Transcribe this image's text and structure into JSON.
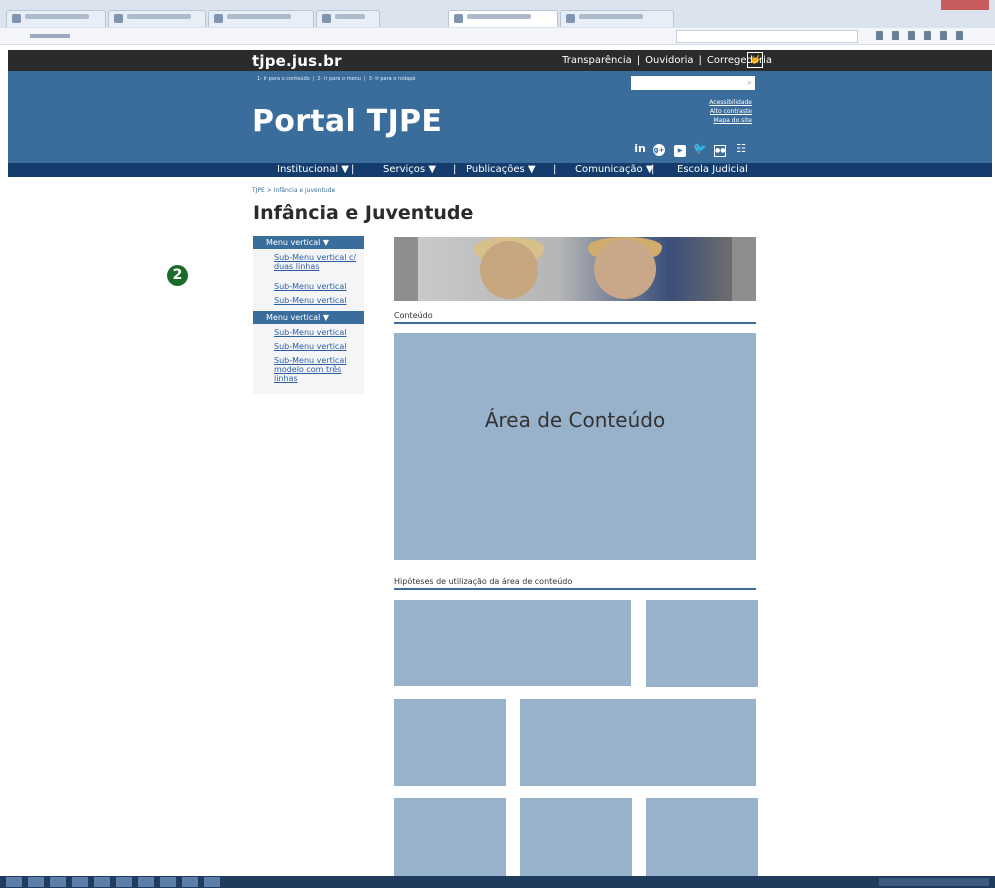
{
  "header": {
    "site_name": "tjpe.jus.br",
    "top_links": [
      "Transparência",
      "Ouvidoria",
      "Corregedoria"
    ],
    "libras_icon": "libras-icon",
    "skip_links": [
      "1- Ir para o conteúdo",
      "2- Ir para o menu",
      "3- Ir para o rodapé"
    ],
    "portal_title": "Portal TJPE",
    "accessibility_links": [
      "Acessibilidade",
      "Alto contraste",
      "Mapa do site"
    ],
    "social_icons": [
      "linkedin-icon",
      "google-plus-icon",
      "youtube-icon",
      "twitter-icon",
      "flickr-icon",
      "rss-icon"
    ]
  },
  "nav": {
    "items": [
      "Institucional ▼",
      "Serviços ▼",
      "Publicações ▼",
      "Comunicação ▼",
      "Escola Judicial"
    ]
  },
  "breadcrumb": "TJPE > Infância e juventude",
  "page_title": "Infância e Juventude",
  "sidebar": {
    "menus": [
      {
        "label": "Menu vertical ▼",
        "items": [
          "Sub-Menu vertical c/ duas linhas",
          "Sub-Menu vertical",
          "Sub-Menu vertical"
        ]
      },
      {
        "label": "Menu vertical ▼",
        "items": [
          "Sub-Menu vertical",
          "Sub-Menu vertical",
          "Sub-Menu vertical modelo com três linhas"
        ]
      }
    ]
  },
  "main": {
    "content_section_label": "Conteúdo",
    "content_area_label": "Área de Conteúdo",
    "hypotheses_label": "Hipóteses de utilização da área de conteúdo"
  },
  "annotation": {
    "step_marker": "❷"
  },
  "colors": {
    "brand_blue": "#3a6d9c",
    "nav_dark_blue": "#143d6e",
    "content_box": "#99b2cb",
    "top_bar": "#2b2b2b",
    "step_green": "#1d6b2a"
  }
}
